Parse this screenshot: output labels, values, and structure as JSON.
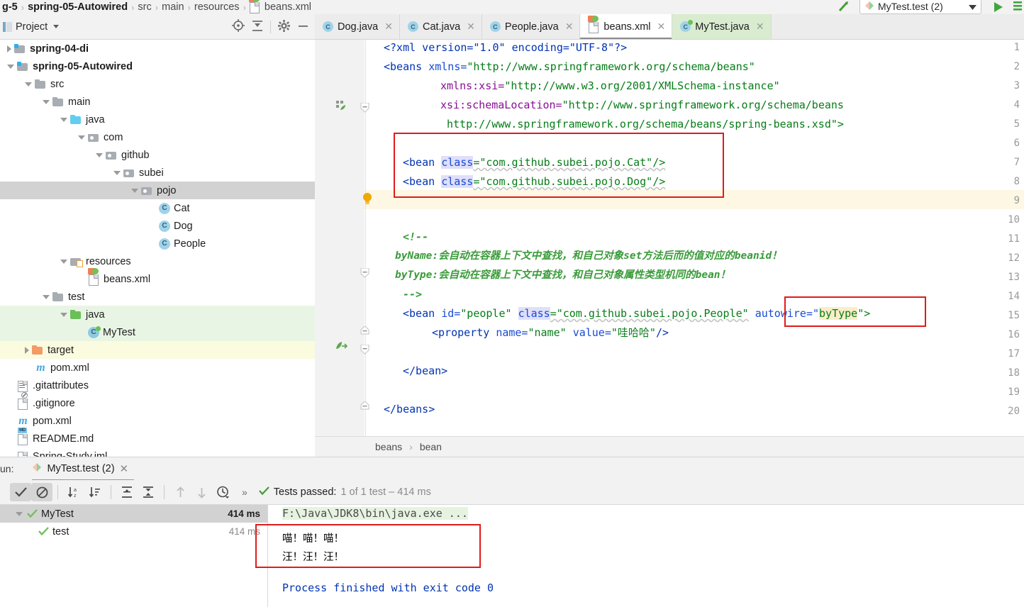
{
  "topbar": {
    "breadcrumb": [
      "g-5",
      "spring-05-Autowired",
      "src",
      "main",
      "resources",
      "beans.xml"
    ],
    "run_config": "MyTest.test (2)",
    "icons": {
      "arrow_up": "arrow-up-green-icon",
      "run": "run-play-icon",
      "more": "more-green-icon",
      "chevron": "chevron-down-icon"
    }
  },
  "project_panel": {
    "title": "Project",
    "icons": [
      "locate-icon",
      "collapse-all-icon",
      "gear-icon",
      "minimize-icon"
    ],
    "tree": [
      {
        "label": "spring-04-di",
        "indent": 0,
        "arrow": "collapsed",
        "icon": "folder-module",
        "bold": true,
        "state": ""
      },
      {
        "label": "spring-05-Autowired",
        "indent": 0,
        "arrow": "expanded",
        "icon": "folder-module",
        "bold": true,
        "state": ""
      },
      {
        "label": "src",
        "indent": 1,
        "arrow": "expanded",
        "icon": "folder-gray",
        "bold": false,
        "state": ""
      },
      {
        "label": "main",
        "indent": 2,
        "arrow": "expanded",
        "icon": "folder-gray",
        "bold": false,
        "state": ""
      },
      {
        "label": "java",
        "indent": 3,
        "arrow": "expanded",
        "icon": "folder-cyan",
        "bold": false,
        "state": ""
      },
      {
        "label": "com",
        "indent": 4,
        "arrow": "expanded",
        "icon": "folder-package",
        "bold": false,
        "state": ""
      },
      {
        "label": "github",
        "indent": 5,
        "arrow": "expanded",
        "icon": "folder-package",
        "bold": false,
        "state": ""
      },
      {
        "label": "subei",
        "indent": 6,
        "arrow": "expanded",
        "icon": "folder-package",
        "bold": false,
        "state": ""
      },
      {
        "label": "pojo",
        "indent": 7,
        "arrow": "expanded",
        "icon": "folder-package",
        "bold": false,
        "state": "selected"
      },
      {
        "label": "Cat",
        "indent": 8,
        "arrow": "none",
        "icon": "java-class",
        "bold": false,
        "state": ""
      },
      {
        "label": "Dog",
        "indent": 8,
        "arrow": "none",
        "icon": "java-class",
        "bold": false,
        "state": ""
      },
      {
        "label": "People",
        "indent": 8,
        "arrow": "none",
        "icon": "java-class",
        "bold": false,
        "state": ""
      },
      {
        "label": "resources",
        "indent": 3,
        "arrow": "expanded",
        "icon": "folder-resources",
        "bold": false,
        "state": ""
      },
      {
        "label": "beans.xml",
        "indent": 4,
        "arrow": "none",
        "icon": "xml-spring-file",
        "bold": false,
        "state": ""
      },
      {
        "label": "test",
        "indent": 2,
        "arrow": "expanded",
        "icon": "folder-gray",
        "bold": false,
        "state": ""
      },
      {
        "label": "java",
        "indent": 3,
        "arrow": "expanded",
        "icon": "folder-green",
        "bold": false,
        "state": "green"
      },
      {
        "label": "MyTest",
        "indent": 4,
        "arrow": "none",
        "icon": "java-test-class",
        "bold": false,
        "state": "green"
      },
      {
        "label": "target",
        "indent": 1,
        "arrow": "collapsed",
        "icon": "folder-orange",
        "bold": false,
        "state": "yellow"
      },
      {
        "label": "pom.xml",
        "indent": 1,
        "arrow": "none",
        "icon": "maven-file",
        "bold": false,
        "state": ""
      },
      {
        "label": ".gitattributes",
        "indent": 0,
        "arrow": "none",
        "icon": "text-file",
        "bold": false,
        "state": ""
      },
      {
        "label": ".gitignore",
        "indent": 0,
        "arrow": "none",
        "icon": "gitignore-file",
        "bold": false,
        "state": ""
      },
      {
        "label": "pom.xml",
        "indent": 0,
        "arrow": "none",
        "icon": "maven-file",
        "bold": false,
        "state": ""
      },
      {
        "label": "README.md",
        "indent": 0,
        "arrow": "none",
        "icon": "markdown-file",
        "bold": false,
        "state": ""
      },
      {
        "label": "Spring-Study.iml",
        "indent": 0,
        "arrow": "none",
        "icon": "iml-file",
        "bold": false,
        "state": ""
      }
    ]
  },
  "editor_tabs": [
    {
      "label": "Dog.java",
      "icon": "java-class-icon",
      "active": false,
      "green": false
    },
    {
      "label": "Cat.java",
      "icon": "java-class-icon",
      "active": false,
      "green": false
    },
    {
      "label": "People.java",
      "icon": "java-class-icon",
      "active": false,
      "green": false
    },
    {
      "label": "beans.xml",
      "icon": "xml-spring-icon",
      "active": true,
      "green": false
    },
    {
      "label": "MyTest.java",
      "icon": "java-test-icon",
      "active": false,
      "green": true
    }
  ],
  "editor": {
    "line_numbers": [
      "1",
      "2",
      "3",
      "4",
      "5",
      "6",
      "7",
      "8",
      "9",
      "10",
      "11",
      "12",
      "13",
      "14",
      "15",
      "16",
      "17",
      "18",
      "19",
      "20"
    ],
    "code": {
      "l1_decl": "<?xml version=\"1.0\" encoding=\"UTF-8\"?>",
      "l2_tag": "<beans ",
      "l2_attr": "xmlns=",
      "l2_val": "\"http://www.springframework.org/schema/beans\"",
      "l3_attr": "xmlns:xsi=",
      "l3_val": "\"http://www.w3.org/2001/XMLSchema-instance\"",
      "l4_attr": "xsi:schemaLocation=",
      "l4_val": "\"http://www.springframework.org/schema/beans",
      "l5_val": "http://www.springframework.org/schema/beans/spring-beans.xsd\">",
      "l7_tag": "<bean ",
      "l7_attr": "class",
      "l7_val": "=\"com.github.subei.pojo.Cat\"/>",
      "l8_tag": "<bean ",
      "l8_attr": "class",
      "l8_val": "=\"com.github.subei.pojo.Dog\"/>",
      "l11_cmt": "<!--",
      "l12_cmt": "byName:会自动在容器上下文中查找，和自己对象set方法后而的值对应的beanid！",
      "l13_cmt": "byType:会自动在容器上下文中查找，和自己对象属性类型机同的bean！",
      "l14_cmt": "-->",
      "l15_tag": "<bean ",
      "l15_attr_id": "id=",
      "l15_val_id": "\"people\" ",
      "l15_attr_cls": "class",
      "l15_val_cls": "=\"com.github.subei.pojo.People\"",
      "l15_attr_aw": " autowire=\"",
      "l15_val_aw": "byType",
      "l15_close": "\">",
      "l16_tag": "<property ",
      "l16_attr_n": "name=",
      "l16_val_n": "\"name\" ",
      "l16_attr_v": "value=",
      "l16_val_v": "\"哇哈哈\"",
      "l16_close": "/>",
      "l18_close": "</bean>",
      "l20_close": "</beans>"
    },
    "gutter_icons": {
      "line2": "spring-config-icon",
      "line7": "intention-bulb-icon",
      "line15": "spring-bean-icon"
    },
    "breadcrumb": [
      "beans",
      "bean"
    ],
    "annotations": [
      {
        "name": "bean-definitions-highlight",
        "color": "#e01b1b"
      },
      {
        "name": "autowire-attribute-highlight",
        "color": "#e01b1b"
      }
    ]
  },
  "run_panel": {
    "label": "un:",
    "tab": "MyTest.test (2)",
    "toolbar_icons": [
      "show-passed-icon",
      "hide-ignored-icon",
      "sort-alphabetically-icon",
      "sort-by-duration-icon",
      "expand-all-icon",
      "collapse-all-icon",
      "prev-failed-icon",
      "next-failed-icon",
      "history-icon",
      "more-icon"
    ],
    "status_prefix": "Tests passed:",
    "status_detail": "1 of 1 test – 414 ms",
    "tests": [
      {
        "label": "MyTest",
        "time": "414 ms",
        "state": "passed",
        "selected": true,
        "child": false
      },
      {
        "label": "test",
        "time": "414 ms",
        "state": "passed",
        "selected": false,
        "child": true
      }
    ],
    "console": {
      "command": "F:\\Java\\JDK8\\bin\\java.exe ...",
      "output_line1": "喵！喵！喵！",
      "output_line2": "汪！汪！汪！",
      "exit_line": "Process finished with exit code 0"
    }
  }
}
